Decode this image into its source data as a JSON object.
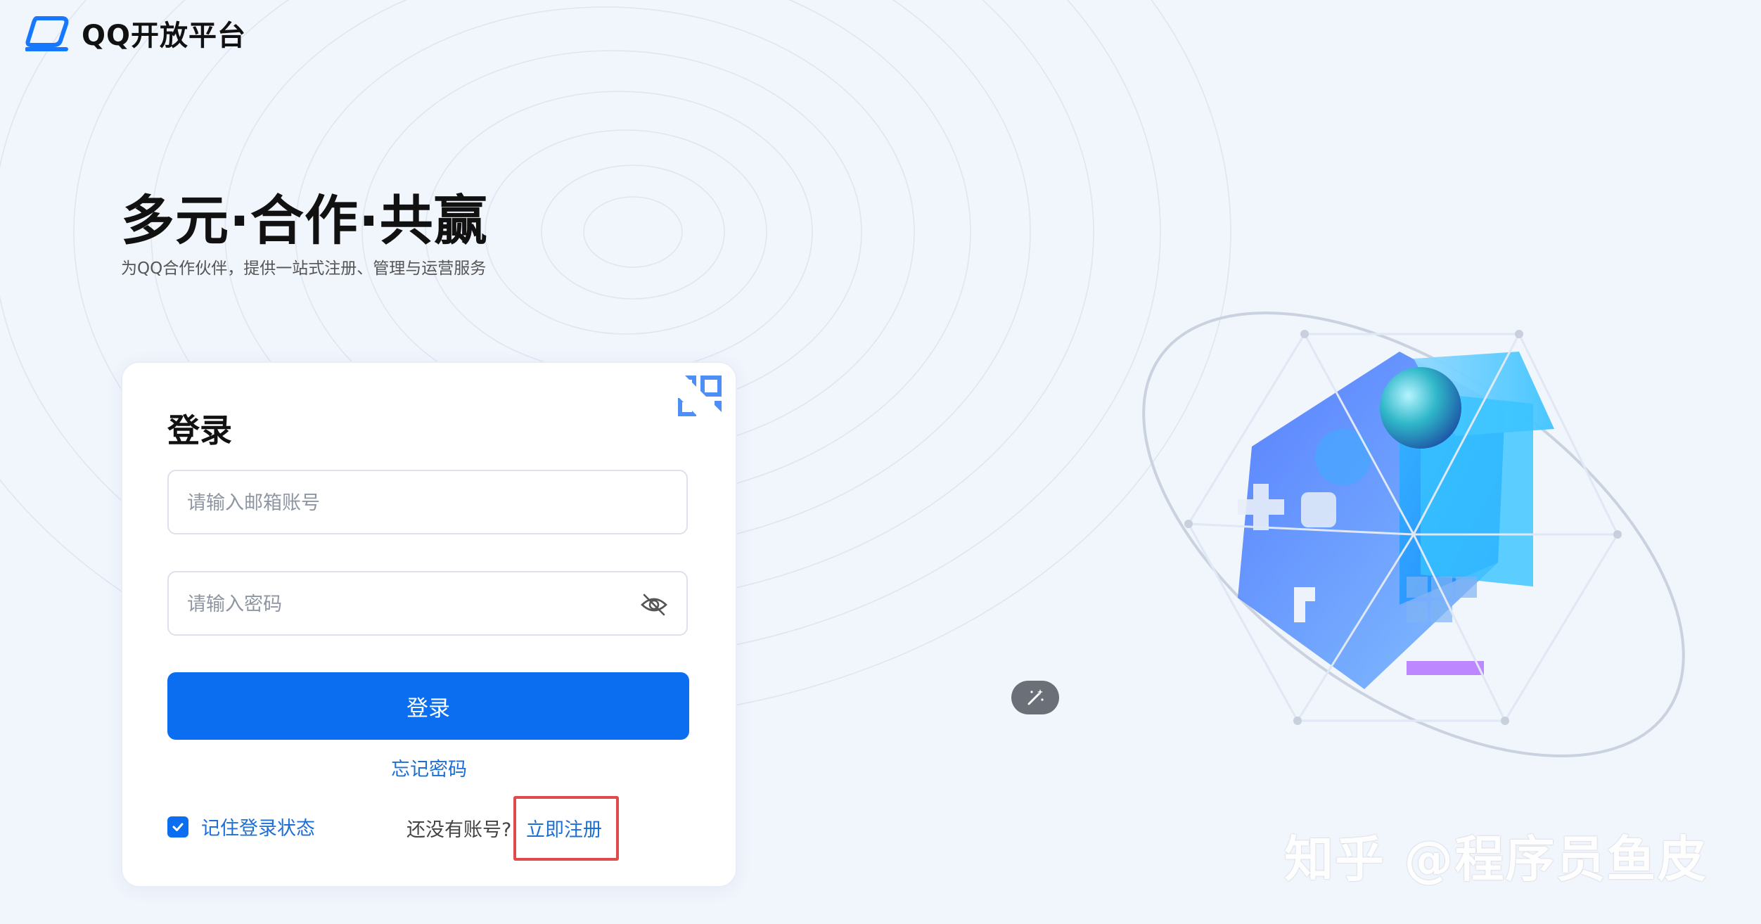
{
  "brand": {
    "name": "QQ开放平台"
  },
  "hero": {
    "title": "多元·合作·共赢",
    "subtitle": "为QQ合作伙伴，提供一站式注册、管理与运营服务"
  },
  "login": {
    "title": "登录",
    "email_placeholder": "请输入邮箱账号",
    "password_placeholder": "请输入密码",
    "submit_label": "登录",
    "forgot_label": "忘记密码",
    "remember_label": "记住登录状态",
    "remember_checked": true,
    "no_account_text": "还没有账号?",
    "register_label": "立即注册"
  },
  "icons": {
    "qr": "qr-code-icon",
    "eye": "eye-off-icon",
    "magic": "magic-wand-icon",
    "check": "check-icon"
  },
  "colors": {
    "accent": "#0b6ef0",
    "link": "#1d6fd6",
    "highlight": "#e04a4a",
    "background": "#f1f5fc"
  },
  "watermark": {
    "text": "知乎 @程序员鱼皮"
  }
}
